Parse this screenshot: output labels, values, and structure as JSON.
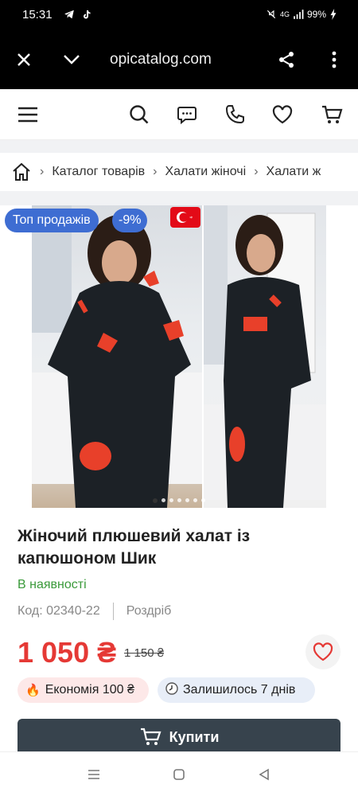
{
  "status_bar": {
    "time": "15:31",
    "network": "4G",
    "battery": "99%"
  },
  "browser": {
    "url": "opicatalog.com"
  },
  "breadcrumb": {
    "items": [
      "Каталог товарів",
      "Халати жіночі",
      "Халати ж"
    ]
  },
  "gallery": {
    "badge_top": "Топ продажів",
    "badge_discount": "-9%",
    "dots_total": 7,
    "dots_active": 1
  },
  "product": {
    "title": "Жіночий плюшевий халат із капюшоном Шик",
    "stock": "В наявності",
    "code": "Код: 02340-22",
    "sale_type": "Роздріб",
    "price": "1 050 ₴",
    "old_price": "1 150 ₴",
    "economy": "Економія 100 ₴",
    "days_left": "Залишилось 7 днів",
    "buy_label": "Купити"
  },
  "colors": {
    "accent_blue": "#3e6dd2",
    "price_red": "#e53935",
    "stock_green": "#3a9a3a",
    "buy_button": "#37434d"
  }
}
